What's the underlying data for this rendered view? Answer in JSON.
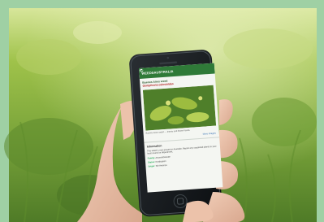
{
  "app": {
    "title": "WEEDSAUSTRALIA",
    "plant_name": "Buenos Aires weed",
    "plant_sci": "Gomphrena celosioides",
    "photo_caption": "Buenos Aires weed — leaves and flower heads",
    "more_link": "More images",
    "section_title": "Information",
    "info_text": "This weed is now present in Australia. Report any suspected plants to your local council or department.",
    "fields": [
      {
        "k": "Family:",
        "v": "Amaranthaceae"
      },
      {
        "k": "Status:",
        "v": "Eradication"
      },
      {
        "k": "Origin:",
        "v": "Sth America"
      }
    ]
  },
  "colors": {
    "frame_accent": "#9fd0a4",
    "app_bar": "#2f7a38",
    "sci_name": "#b22020"
  }
}
